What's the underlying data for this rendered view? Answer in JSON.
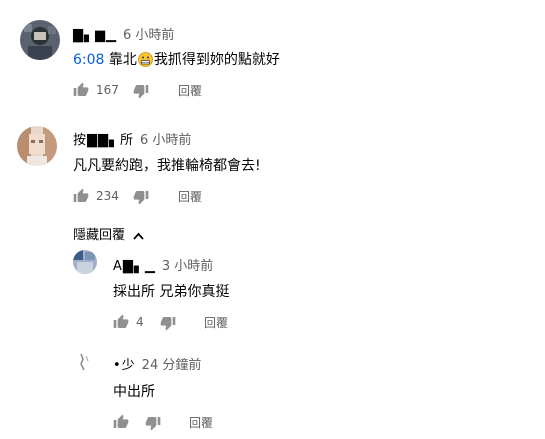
{
  "comments": [
    {
      "author": "▇▖▆▁",
      "time": "6 小時前",
      "timestamp_link": "6:08",
      "text_a": " 靠北",
      "text_b": "我抓得到妳的點就好",
      "likes": "167",
      "reply_label": "回覆"
    },
    {
      "author": "按▇▇▖所",
      "time": "6 小時前",
      "text": "凡凡要約跑，我推輪椅都會去!",
      "likes": "234",
      "reply_label": "回覆"
    }
  ],
  "hide_replies_label": "隱藏回覆",
  "replies": [
    {
      "author": "A▇▖▁",
      "time": "3 小時前",
      "text": "採出所 兄弟你真挺",
      "likes": "4",
      "reply_label": "回覆"
    },
    {
      "author": "•少",
      "time": "24 分鐘前",
      "text": "中出所",
      "likes": "",
      "reply_label": "回覆"
    }
  ],
  "colors": {
    "link": "#065fd4",
    "secondary": "#606060",
    "icon": "#909090",
    "primary": "#030303"
  }
}
